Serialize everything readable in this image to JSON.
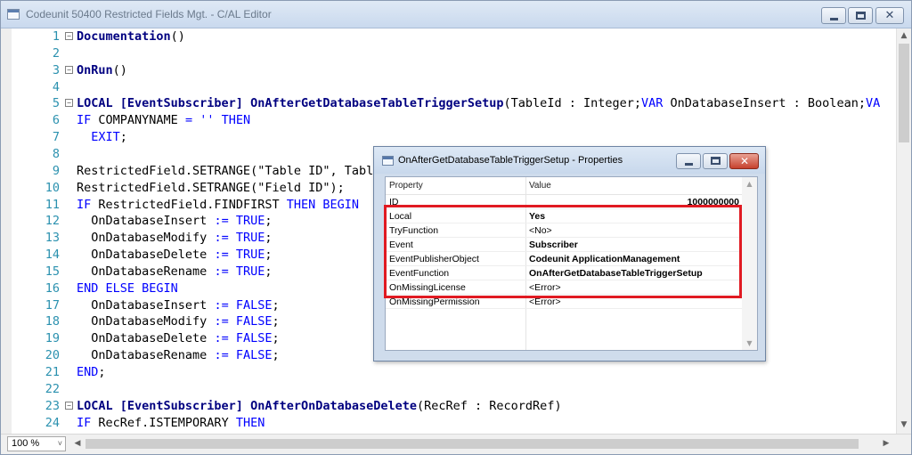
{
  "window": {
    "title": "Codeunit 50400 Restricted Fields Mgt. - C/AL Editor",
    "close_glyph": "✕"
  },
  "code_lines": [
    {
      "num": "1",
      "fold": "−",
      "segments": [
        {
          "t": "Documentation",
          "c": "tr"
        },
        {
          "t": "()",
          "c": ""
        }
      ]
    },
    {
      "num": "2",
      "fold": "",
      "segments": []
    },
    {
      "num": "3",
      "fold": "−",
      "segments": [
        {
          "t": "OnRun",
          "c": "tr"
        },
        {
          "t": "()",
          "c": ""
        }
      ]
    },
    {
      "num": "4",
      "fold": "",
      "segments": []
    },
    {
      "num": "5",
      "fold": "−",
      "segments": [
        {
          "t": "LOCAL [EventSubscriber] OnAfterGetDatabaseTableTriggerSetup",
          "c": "tr"
        },
        {
          "t": "(TableId : Integer;",
          "c": ""
        },
        {
          "t": "VAR",
          "c": "kw"
        },
        {
          "t": " OnDatabaseInsert : Boolean;",
          "c": ""
        },
        {
          "t": "VA",
          "c": "kw"
        }
      ]
    },
    {
      "num": "6",
      "fold": "",
      "segments": [
        {
          "t": "IF",
          "c": "kw"
        },
        {
          "t": " COMPANYNAME ",
          "c": ""
        },
        {
          "t": "= '' THEN",
          "c": "kw"
        }
      ]
    },
    {
      "num": "7",
      "fold": "",
      "segments": [
        {
          "t": "  ",
          "c": ""
        },
        {
          "t": "EXIT",
          "c": "kw"
        },
        {
          "t": ";",
          "c": ""
        }
      ]
    },
    {
      "num": "8",
      "fold": "",
      "segments": []
    },
    {
      "num": "9",
      "fold": "",
      "segments": [
        {
          "t": "RestrictedField.SETRANGE(\"Table ID\", Tabl",
          "c": ""
        }
      ]
    },
    {
      "num": "10",
      "fold": "",
      "segments": [
        {
          "t": "RestrictedField.SETRANGE(\"Field ID\");",
          "c": ""
        }
      ]
    },
    {
      "num": "11",
      "fold": "",
      "segments": [
        {
          "t": "IF",
          "c": "kw"
        },
        {
          "t": " RestrictedField.FINDFIRST ",
          "c": ""
        },
        {
          "t": "THEN BEGIN",
          "c": "kw"
        }
      ]
    },
    {
      "num": "12",
      "fold": "",
      "segments": [
        {
          "t": "  OnDatabaseInsert ",
          "c": ""
        },
        {
          "t": ":= TRUE",
          "c": "kw"
        },
        {
          "t": ";",
          "c": ""
        }
      ]
    },
    {
      "num": "13",
      "fold": "",
      "segments": [
        {
          "t": "  OnDatabaseModify ",
          "c": ""
        },
        {
          "t": ":= TRUE",
          "c": "kw"
        },
        {
          "t": ";",
          "c": ""
        }
      ]
    },
    {
      "num": "14",
      "fold": "",
      "segments": [
        {
          "t": "  OnDatabaseDelete ",
          "c": ""
        },
        {
          "t": ":= TRUE",
          "c": "kw"
        },
        {
          "t": ";",
          "c": ""
        }
      ]
    },
    {
      "num": "15",
      "fold": "",
      "segments": [
        {
          "t": "  OnDatabaseRename ",
          "c": ""
        },
        {
          "t": ":= TRUE",
          "c": "kw"
        },
        {
          "t": ";",
          "c": ""
        }
      ]
    },
    {
      "num": "16",
      "fold": "",
      "segments": [
        {
          "t": "END ELSE BEGIN",
          "c": "kw"
        }
      ]
    },
    {
      "num": "17",
      "fold": "",
      "segments": [
        {
          "t": "  OnDatabaseInsert ",
          "c": ""
        },
        {
          "t": ":= FALSE",
          "c": "kw"
        },
        {
          "t": ";",
          "c": ""
        }
      ]
    },
    {
      "num": "18",
      "fold": "",
      "segments": [
        {
          "t": "  OnDatabaseModify ",
          "c": ""
        },
        {
          "t": ":= FALSE",
          "c": "kw"
        },
        {
          "t": ";",
          "c": ""
        }
      ]
    },
    {
      "num": "19",
      "fold": "",
      "segments": [
        {
          "t": "  OnDatabaseDelete ",
          "c": ""
        },
        {
          "t": ":= FALSE",
          "c": "kw"
        },
        {
          "t": ";",
          "c": ""
        }
      ]
    },
    {
      "num": "20",
      "fold": "",
      "segments": [
        {
          "t": "  OnDatabaseRename ",
          "c": ""
        },
        {
          "t": ":= FALSE",
          "c": "kw"
        },
        {
          "t": ";",
          "c": ""
        }
      ]
    },
    {
      "num": "21",
      "fold": "",
      "segments": [
        {
          "t": "END",
          "c": "kw"
        },
        {
          "t": ";",
          "c": ""
        }
      ]
    },
    {
      "num": "22",
      "fold": "",
      "segments": []
    },
    {
      "num": "23",
      "fold": "−",
      "segments": [
        {
          "t": "LOCAL [EventSubscriber] OnAfterOnDatabaseDelete",
          "c": "tr"
        },
        {
          "t": "(RecRef : RecordRef)",
          "c": ""
        }
      ]
    },
    {
      "num": "24",
      "fold": "",
      "segments": [
        {
          "t": "IF",
          "c": "kw"
        },
        {
          "t": " RecRef.ISTEMPORARY ",
          "c": ""
        },
        {
          "t": "THEN",
          "c": "kw"
        }
      ]
    }
  ],
  "status": {
    "zoom": "100 %",
    "zoom_arrow": "˅"
  },
  "properties": {
    "title": "OnAfterGetDatabaseTableTriggerSetup - Properties",
    "close_glyph": "✕",
    "col_property": "Property",
    "col_value": "Value",
    "rows": [
      {
        "name": "ID",
        "value": "1000000000",
        "bold": true,
        "align": "right"
      },
      {
        "name": "Local",
        "value": "Yes",
        "bold": true
      },
      {
        "name": "TryFunction",
        "value": "<No>",
        "bold": false
      },
      {
        "name": "Event",
        "value": "Subscriber",
        "bold": true
      },
      {
        "name": "EventPublisherObject",
        "value": "Codeunit ApplicationManagement",
        "bold": true
      },
      {
        "name": "EventFunction",
        "value": "OnAfterGetDatabaseTableTriggerSetup",
        "bold": true
      },
      {
        "name": "OnMissingLicense",
        "value": "<Error>",
        "bold": false
      },
      {
        "name": "OnMissingPermission",
        "value": "<Error>",
        "bold": false
      }
    ]
  },
  "colors": {
    "highlight": "#e01a22",
    "keyword": "#0000ff",
    "trigger": "#000080",
    "line_number": "#2b91af"
  }
}
